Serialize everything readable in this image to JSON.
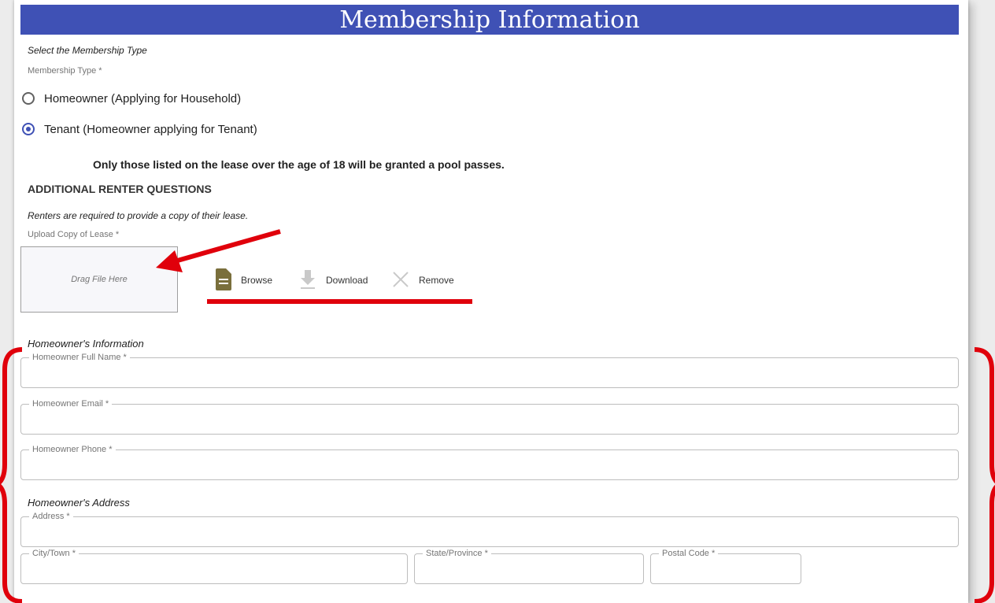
{
  "banner_title": "Membership Information",
  "membership": {
    "prompt": "Select the Membership Type",
    "field_label": "Membership Type *",
    "options": [
      {
        "label": "Homeowner (Applying for Household)",
        "selected": false
      },
      {
        "label": "Tenant (Homeowner applying for Tenant)",
        "selected": true
      }
    ],
    "notice": "Only those listed on the lease over the age of 18 will be granted a pool passes."
  },
  "renter": {
    "heading": "ADDITIONAL RENTER QUESTIONS",
    "instruction": "Renters are required to provide a copy of their lease.",
    "upload_label": "Upload Copy of Lease *",
    "dropzone_text": "Drag File Here",
    "browse_label": "Browse",
    "download_label": "Download",
    "remove_label": "Remove"
  },
  "homeowner_info": {
    "title": "Homeowner's Information",
    "full_name_label": "Homeowner Full Name *",
    "email_label": "Homeowner Email *",
    "phone_label": "Homeowner Phone *"
  },
  "homeowner_address": {
    "title": "Homeowner's Address",
    "address_label": "Address *",
    "city_label": "City/Town *",
    "state_label": "State/Province *",
    "postal_label": "Postal Code *"
  },
  "colors": {
    "banner": "#3f51b5",
    "radio_selected": "#3f51b5",
    "annotation_red": "#e0000b",
    "file_icon": "#7a6f3c"
  },
  "icons": [
    "file-icon",
    "download-icon",
    "close-icon"
  ]
}
